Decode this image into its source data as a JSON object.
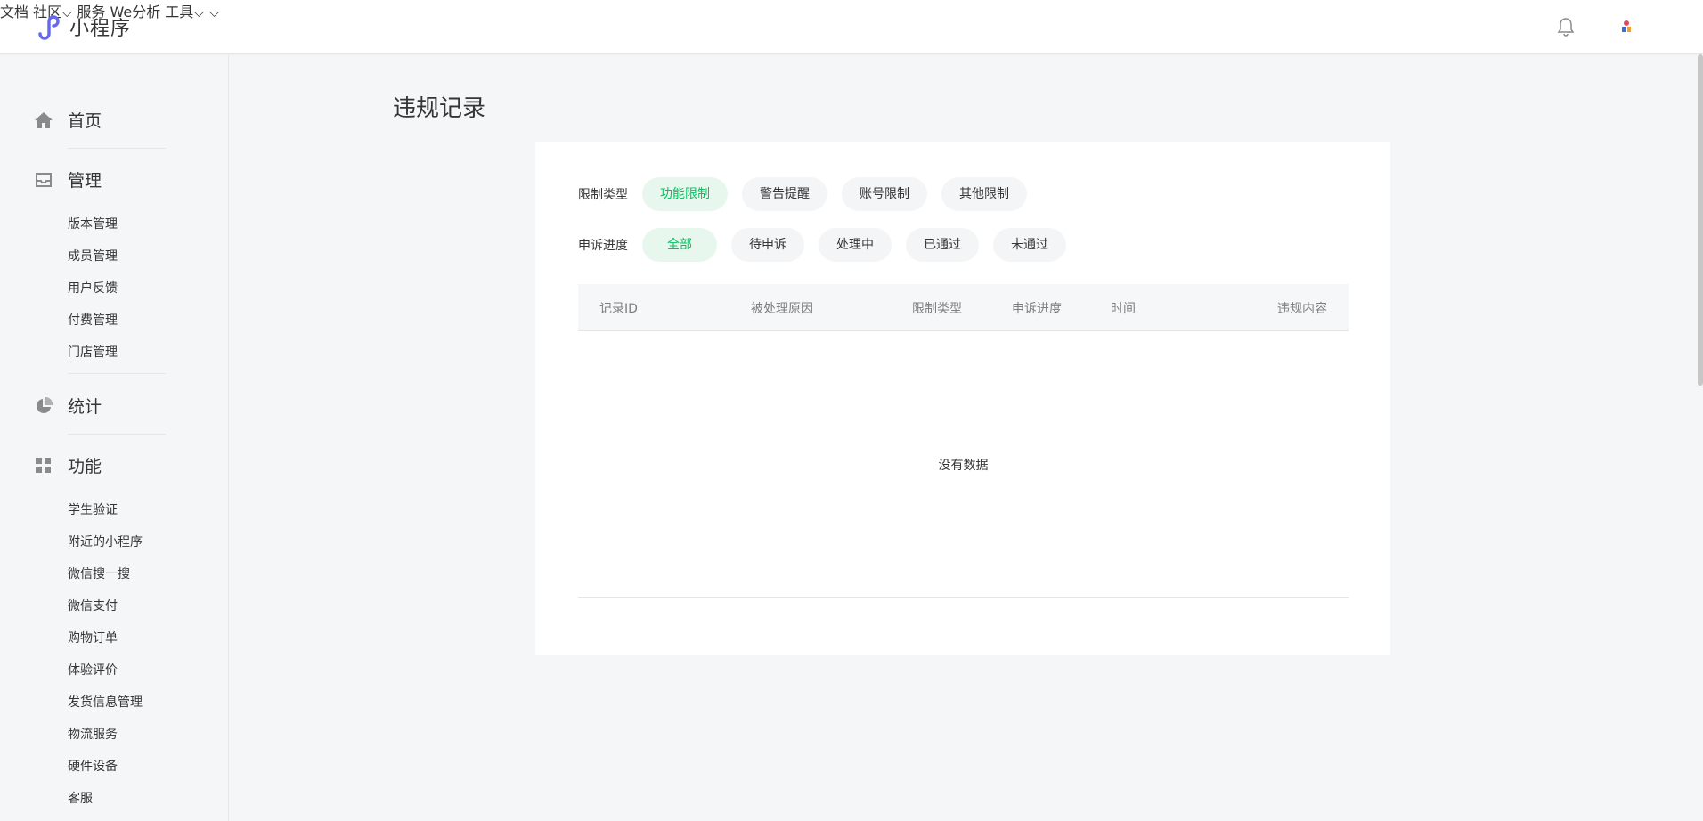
{
  "app": {
    "name": "小程序"
  },
  "topnav": {
    "docs": "文档",
    "community": "社区",
    "service": "服务",
    "we_analytics": "We分析",
    "tools": "工具"
  },
  "sidebar": {
    "home": "首页",
    "manage": "管理",
    "manage_items": [
      "版本管理",
      "成员管理",
      "用户反馈",
      "付费管理",
      "门店管理"
    ],
    "stats": "统计",
    "features": "功能",
    "feature_items": [
      "学生验证",
      "附近的小程序",
      "微信搜一搜",
      "微信支付",
      "购物订单",
      "体验评价",
      "发货信息管理",
      "物流服务",
      "硬件设备",
      "客服"
    ]
  },
  "page": {
    "title": "违规记录"
  },
  "filters": {
    "restriction_label": "限制类型",
    "restriction_options": [
      "功能限制",
      "警告提醒",
      "账号限制",
      "其他限制"
    ],
    "restriction_selected": "功能限制",
    "appeal_label": "申诉进度",
    "appeal_options": [
      "全部",
      "待申诉",
      "处理中",
      "已通过",
      "未通过"
    ],
    "appeal_selected": "全部"
  },
  "table": {
    "columns": [
      "记录ID",
      "被处理原因",
      "限制类型",
      "申诉进度",
      "时间",
      "违规内容"
    ],
    "empty_text": "没有数据"
  },
  "colors": {
    "accent": "#07c160",
    "accent_bg": "#e8f7ee",
    "brand": "#6467f0"
  }
}
